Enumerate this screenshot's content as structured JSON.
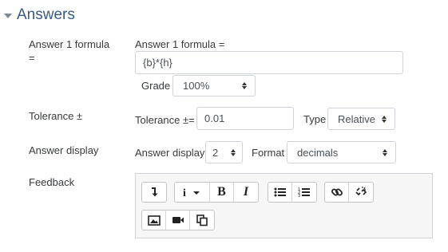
{
  "section": {
    "title": "Answers"
  },
  "answer_formula": {
    "label": "Answer 1 formula =",
    "inline_label": "Answer 1 formula =",
    "value": "{b}*{h}"
  },
  "grade": {
    "label": "Grade",
    "value": "100%"
  },
  "tolerance": {
    "label": "Tolerance ±",
    "inline_label": "Tolerance ±=",
    "value": "0.01",
    "type_label": "Type",
    "type_value": "Relative"
  },
  "answer_display": {
    "label": "Answer display",
    "inline_label": "Answer display",
    "value": "2",
    "format_label": "Format",
    "format_value": "decimals"
  },
  "feedback": {
    "label": "Feedback",
    "toolbar_row1": [
      {
        "name": "toolbar-toggle-icon"
      },
      {
        "name": "info-dropdown-icon"
      },
      {
        "name": "bold-icon"
      },
      {
        "name": "italic-icon"
      },
      {
        "name": "bullet-list-icon"
      },
      {
        "name": "numbered-list-icon"
      },
      {
        "name": "link-icon"
      },
      {
        "name": "unlink-icon"
      }
    ],
    "toolbar_row2": [
      {
        "name": "image-icon"
      },
      {
        "name": "video-icon"
      },
      {
        "name": "copy-icon"
      }
    ]
  }
}
